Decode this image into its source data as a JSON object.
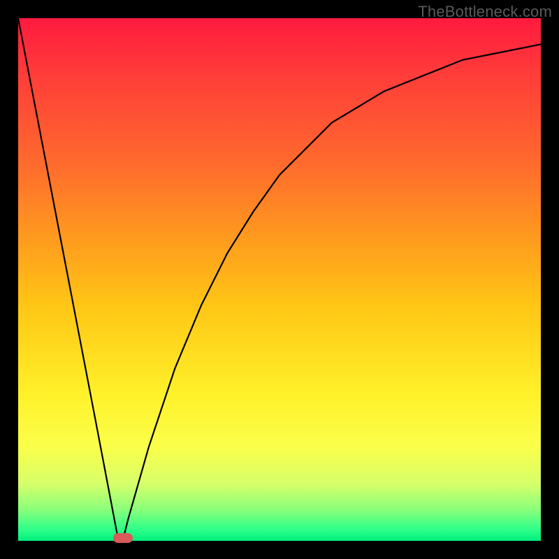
{
  "watermark": "TheBottleneck.com",
  "chart_data": {
    "type": "line",
    "title": "",
    "xlabel": "",
    "ylabel": "",
    "xlim": [
      0,
      100
    ],
    "ylim": [
      0,
      100
    ],
    "x": [
      0,
      5,
      10,
      15,
      19,
      20,
      21,
      25,
      30,
      35,
      40,
      45,
      50,
      55,
      60,
      65,
      70,
      75,
      80,
      85,
      90,
      95,
      100
    ],
    "values": [
      100,
      74,
      48,
      22,
      1,
      0,
      4,
      18,
      33,
      45,
      55,
      63,
      70,
      75,
      80,
      83,
      86,
      88,
      90,
      92,
      93,
      94,
      95
    ],
    "marker": {
      "x": 20,
      "y": 0.5
    },
    "gradient_stops": [
      {
        "pos": 0,
        "color": "#ff1a3e"
      },
      {
        "pos": 10,
        "color": "#ff3a3a"
      },
      {
        "pos": 28,
        "color": "#ff6b2d"
      },
      {
        "pos": 42,
        "color": "#ff9a1e"
      },
      {
        "pos": 55,
        "color": "#ffc615"
      },
      {
        "pos": 72,
        "color": "#fff12a"
      },
      {
        "pos": 82,
        "color": "#fbff4a"
      },
      {
        "pos": 89,
        "color": "#d7ff6a"
      },
      {
        "pos": 94,
        "color": "#8aff7a"
      },
      {
        "pos": 98,
        "color": "#2aff8a"
      },
      {
        "pos": 100,
        "color": "#00f07a"
      }
    ]
  }
}
